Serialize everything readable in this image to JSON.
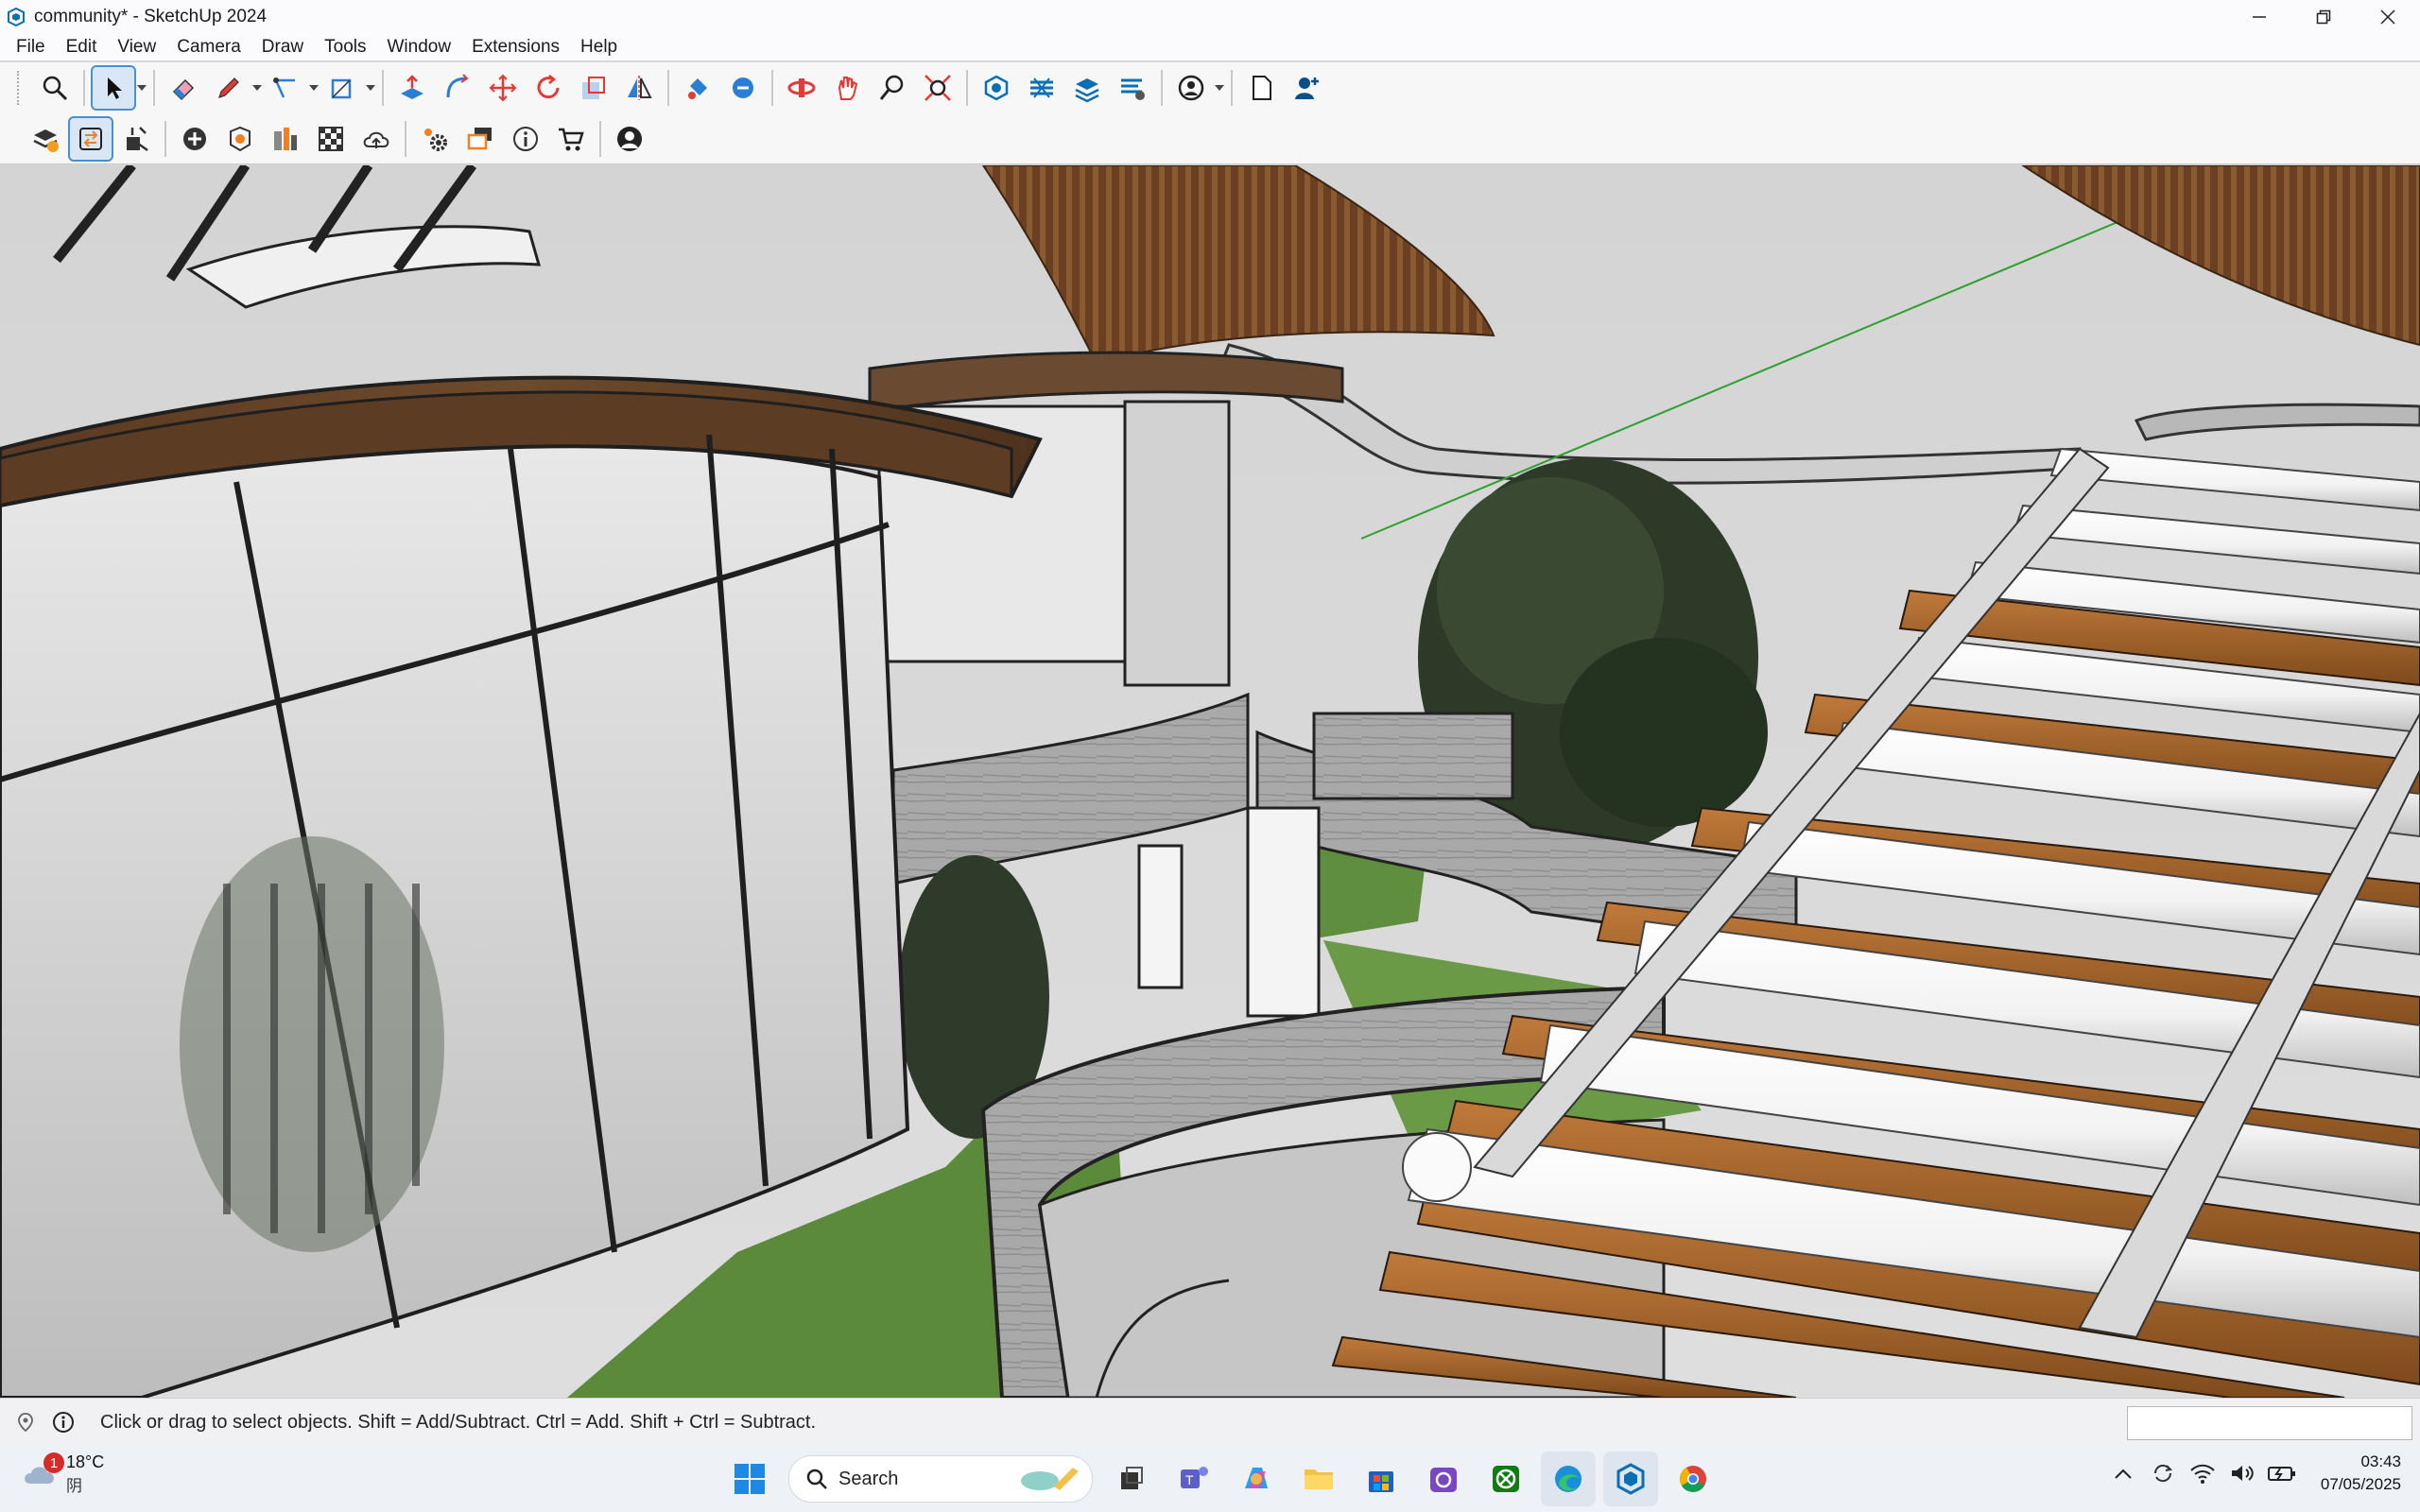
{
  "window": {
    "title": "community* - SketchUp 2024",
    "controls": [
      "minimize",
      "maximize",
      "close"
    ]
  },
  "menu": [
    "File",
    "Edit",
    "View",
    "Camera",
    "Draw",
    "Tools",
    "Window",
    "Extensions",
    "Help"
  ],
  "toolbar_main": [
    "zoom-icon",
    "select-icon",
    "eraser-icon",
    "pencil-icon",
    "line-tool-icon",
    "rectangle-icon",
    "push-pull-icon",
    "follow-me-icon",
    "move-icon",
    "rotate-icon",
    "scale-icon",
    "flip-icon",
    "paint-bucket-icon",
    "sample-paint-icon",
    "orbit-icon",
    "pan-icon",
    "zoom-window-icon",
    "zoom-extents-icon",
    "warehouse-icon",
    "layers-icon",
    "outliner-icon",
    "tags-icon",
    "account-icon",
    "new-file-icon",
    "add-user-icon"
  ],
  "toolbar_secondary": [
    "model-info-icon",
    "swap-icon",
    "export-icon",
    "add-icon",
    "components-icon",
    "materials-icon",
    "pattern-icon",
    "cloud-upload-icon",
    "settings-icon",
    "scenes-icon",
    "info-icon",
    "cart-icon",
    "profile-icon"
  ],
  "status": {
    "text": "Click or drag to select objects. Shift = Add/Subtract. Ctrl = Add. Shift + Ctrl = Subtract.",
    "measurements_value": ""
  },
  "taskbar": {
    "weather_temp": "18°C",
    "weather_cond": "阴",
    "weather_badge": "1",
    "search_placeholder": "Search",
    "apps": [
      "start",
      "search",
      "task-view",
      "teams",
      "copilot",
      "file-explorer",
      "store",
      "outlook",
      "xbox",
      "edge",
      "sketchup",
      "chrome"
    ],
    "time": "03:43",
    "date": "07/05/2025"
  },
  "colors": {
    "accent": "#2a7fd4",
    "sketchup_blue": "#0a6fb5",
    "wood": "#8b5a2b",
    "grass": "#5b8a3a"
  }
}
